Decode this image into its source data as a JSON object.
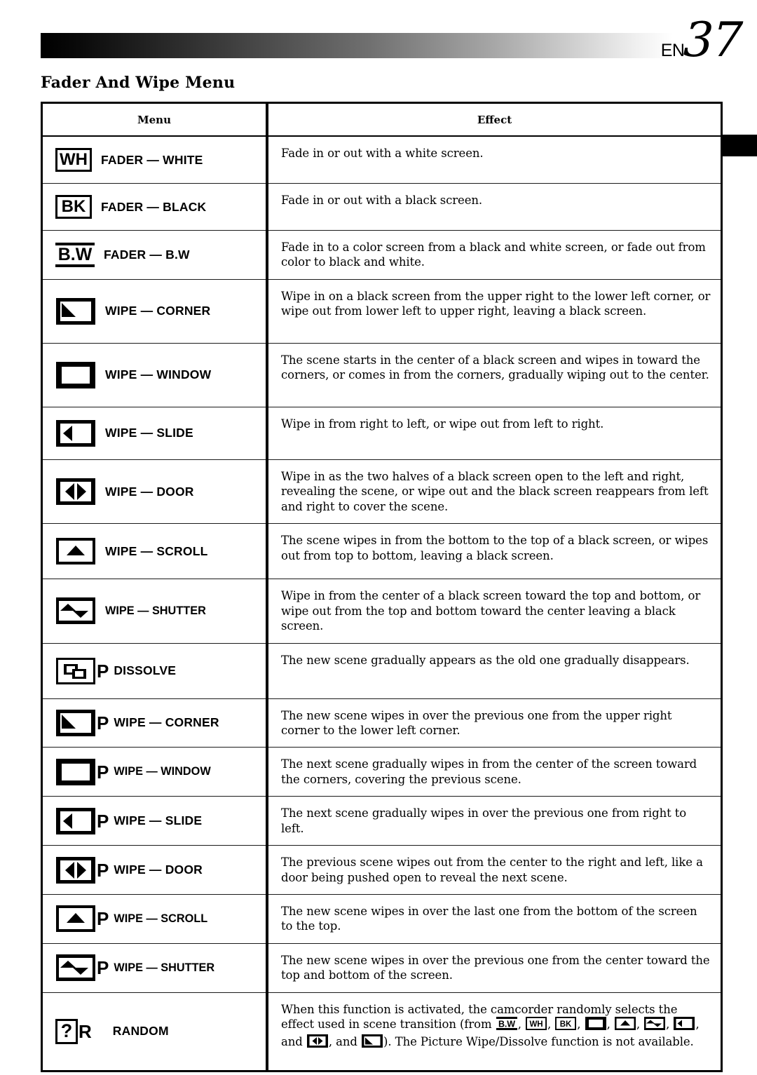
{
  "header": {
    "lang_code": "EN",
    "page_number": "37"
  },
  "section": {
    "title": "Fader And Wipe Menu"
  },
  "table": {
    "columns": [
      "Menu",
      "Effect"
    ],
    "rows": [
      {
        "icon": "fader-white-icon",
        "icon_text": "WH",
        "label": "FADER — WHITE",
        "effect": "Fade in or out with a white screen."
      },
      {
        "icon": "fader-black-icon",
        "icon_text": "BK",
        "label": "FADER — BLACK",
        "effect": "Fade in or out with a black screen."
      },
      {
        "icon": "fader-bw-icon",
        "icon_text": "B.W",
        "label": "FADER — B.W",
        "effect": "Fade in to a color screen from a black and white screen, or fade out from color to black and white."
      },
      {
        "icon": "wipe-corner-icon",
        "label": "WIPE — CORNER",
        "effect": "Wipe in on a black screen from the upper right to the lower left corner, or wipe out from lower left to upper right, leaving a black screen."
      },
      {
        "icon": "wipe-window-icon",
        "label": "WIPE — WINDOW",
        "effect": "The scene starts in the center of a black screen and wipes in toward the corners, or comes in from the corners, gradually wiping out to the center."
      },
      {
        "icon": "wipe-slide-icon",
        "label": "WIPE — SLIDE",
        "effect": "Wipe in from right to left, or wipe out from left to right."
      },
      {
        "icon": "wipe-door-icon",
        "label": "WIPE — DOOR",
        "effect": "Wipe in as the two halves of a black screen open to the left and right, revealing the scene, or wipe out and the black screen reappears from left and right to cover the scene."
      },
      {
        "icon": "wipe-scroll-icon",
        "label": "WIPE — SCROLL",
        "effect": "The scene wipes in from the bottom to the top of a black screen, or wipes out from top to bottom, leaving a black screen."
      },
      {
        "icon": "wipe-shutter-icon",
        "label": "WIPE — SHUTTER",
        "effect": "Wipe in from the center of a black screen toward the top and bottom, or wipe out from the top and bottom toward the center leaving a black screen."
      },
      {
        "icon": "dissolve-icon",
        "p_mark": "P",
        "label": "DISSOLVE",
        "effect": "The new scene gradually appears as the old one gradually disappears."
      },
      {
        "icon": "picture-wipe-corner-icon",
        "p_mark": "P",
        "label": "WIPE — CORNER",
        "effect": "The new scene wipes in over the previous one from the upper right corner to the lower left corner."
      },
      {
        "icon": "picture-wipe-window-icon",
        "p_mark": "P",
        "label": "WIPE — WINDOW",
        "effect": "The next scene gradually wipes in from the center of the screen toward the corners, covering the previous scene."
      },
      {
        "icon": "picture-wipe-slide-icon",
        "p_mark": "P",
        "label": "WIPE — SLIDE",
        "effect": "The next scene gradually wipes in over the previous one from right to left."
      },
      {
        "icon": "picture-wipe-door-icon",
        "p_mark": "P",
        "label": "WIPE — DOOR",
        "effect": "The previous scene wipes out from the center to the right and left, like a door being pushed open to reveal the next scene."
      },
      {
        "icon": "picture-wipe-scroll-icon",
        "p_mark": "P",
        "label": "WIPE — SCROLL",
        "effect": "The new scene wipes in over the last one from the bottom of the screen to the top."
      },
      {
        "icon": "picture-wipe-shutter-icon",
        "p_mark": "P",
        "label": "WIPE — SHUTTER",
        "effect": "The new scene wipes in over the previous one from the center toward the top and bottom of the screen."
      },
      {
        "icon": "random-icon",
        "icon_text": "?",
        "r_mark": "R",
        "label": "RANDOM",
        "effect_part1": "When this function is activated, the camcorder randomly selects the effect used in scene transition (from ",
        "effect_part2": ", ",
        "effect_part3": ", ",
        "effect_part4": ", ",
        "effect_part5": ", ",
        "effect_part6": ", ",
        "effect_part7": ", ",
        "effect_part8": ", and ",
        "effect_part9": "). The Picture Wipe/Dissolve function is not available."
      }
    ]
  }
}
